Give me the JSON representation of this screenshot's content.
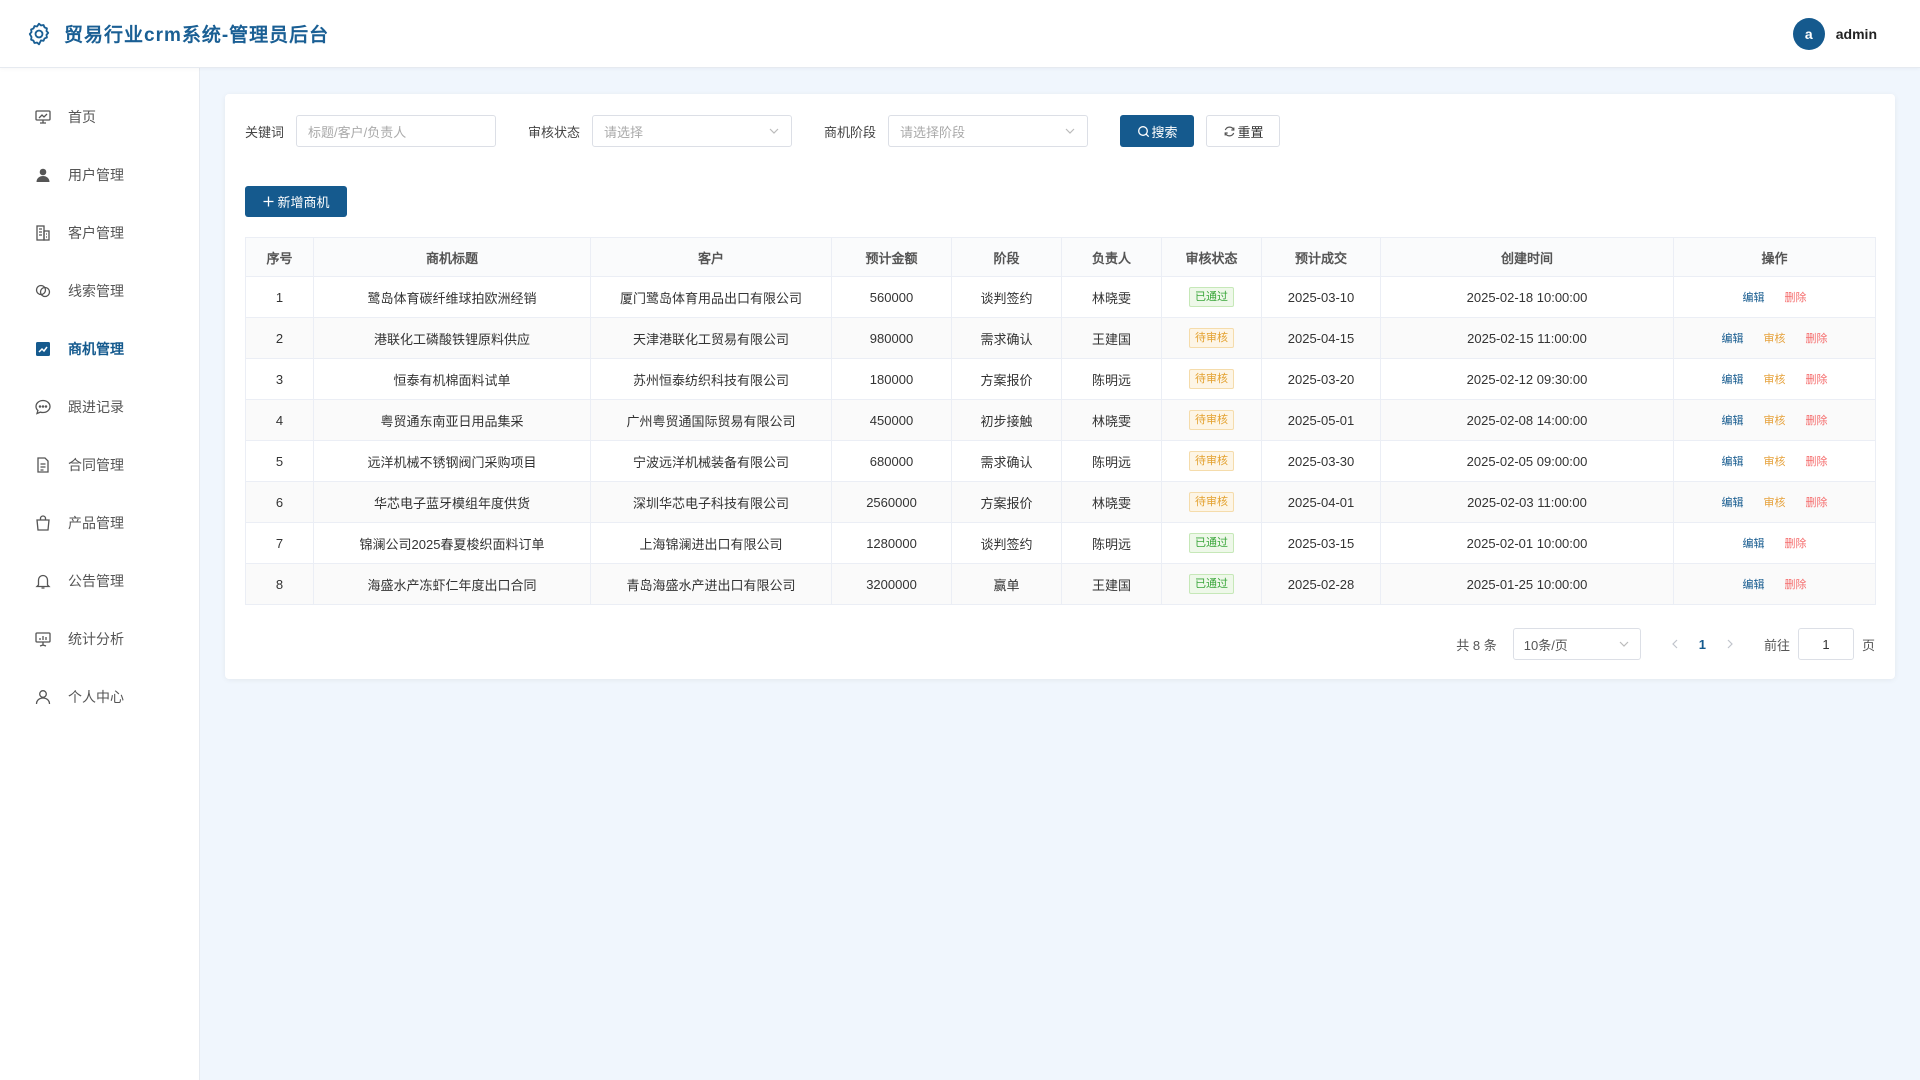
{
  "header": {
    "title": "贸易行业crm系统-管理员后台",
    "avatar_letter": "a",
    "username": "admin"
  },
  "sidebar": {
    "items": [
      {
        "label": "首页",
        "icon": "chart-board-icon"
      },
      {
        "label": "用户管理",
        "icon": "user-icon"
      },
      {
        "label": "客户管理",
        "icon": "building-icon"
      },
      {
        "label": "线索管理",
        "icon": "link-icon"
      },
      {
        "label": "商机管理",
        "icon": "trend-chart-icon",
        "active": true
      },
      {
        "label": "跟进记录",
        "icon": "chat-dot-icon"
      },
      {
        "label": "合同管理",
        "icon": "document-icon"
      },
      {
        "label": "产品管理",
        "icon": "bag-icon"
      },
      {
        "label": "公告管理",
        "icon": "bell-icon"
      },
      {
        "label": "统计分析",
        "icon": "presentation-icon"
      },
      {
        "label": "个人中心",
        "icon": "person-icon"
      }
    ]
  },
  "filters": {
    "keyword_label": "关键词",
    "keyword_placeholder": "标题/客户/负责人",
    "audit_label": "审核状态",
    "audit_placeholder": "请选择",
    "stage_label": "商机阶段",
    "stage_placeholder": "请选择阶段",
    "search_label": "搜索",
    "reset_label": "重置"
  },
  "add_button": "新增商机",
  "table": {
    "columns": [
      "序号",
      "商机标题",
      "客户",
      "预计金额",
      "阶段",
      "负责人",
      "审核状态",
      "预计成交",
      "创建时间",
      "操作"
    ],
    "rows": [
      {
        "no": "1",
        "title": "鹭岛体育碳纤维球拍欧洲经销",
        "customer": "厦门鹭岛体育用品出口有限公司",
        "amount": "560000",
        "stage": "谈判签约",
        "owner": "林晓雯",
        "status": "已通过",
        "status_type": "pass",
        "deal": "2025-03-10",
        "created": "2025-02-18 10:00:00",
        "audit": false
      },
      {
        "no": "2",
        "title": "港联化工磷酸铁锂原料供应",
        "customer": "天津港联化工贸易有限公司",
        "amount": "980000",
        "stage": "需求确认",
        "owner": "王建国",
        "status": "待审核",
        "status_type": "wait",
        "deal": "2025-04-15",
        "created": "2025-02-15 11:00:00",
        "audit": true
      },
      {
        "no": "3",
        "title": "恒泰有机棉面料试单",
        "customer": "苏州恒泰纺织科技有限公司",
        "amount": "180000",
        "stage": "方案报价",
        "owner": "陈明远",
        "status": "待审核",
        "status_type": "wait",
        "deal": "2025-03-20",
        "created": "2025-02-12 09:30:00",
        "audit": true
      },
      {
        "no": "4",
        "title": "粤贸通东南亚日用品集采",
        "customer": "广州粤贸通国际贸易有限公司",
        "amount": "450000",
        "stage": "初步接触",
        "owner": "林晓雯",
        "status": "待审核",
        "status_type": "wait",
        "deal": "2025-05-01",
        "created": "2025-02-08 14:00:00",
        "audit": true
      },
      {
        "no": "5",
        "title": "远洋机械不锈钢阀门采购项目",
        "customer": "宁波远洋机械装备有限公司",
        "amount": "680000",
        "stage": "需求确认",
        "owner": "陈明远",
        "status": "待审核",
        "status_type": "wait",
        "deal": "2025-03-30",
        "created": "2025-02-05 09:00:00",
        "audit": true
      },
      {
        "no": "6",
        "title": "华芯电子蓝牙模组年度供货",
        "customer": "深圳华芯电子科技有限公司",
        "amount": "2560000",
        "stage": "方案报价",
        "owner": "林晓雯",
        "status": "待审核",
        "status_type": "wait",
        "deal": "2025-04-01",
        "created": "2025-02-03 11:00:00",
        "audit": true
      },
      {
        "no": "7",
        "title": "锦澜公司2025春夏梭织面料订单",
        "customer": "上海锦澜进出口有限公司",
        "amount": "1280000",
        "stage": "谈判签约",
        "owner": "陈明远",
        "status": "已通过",
        "status_type": "pass",
        "deal": "2025-03-15",
        "created": "2025-02-01 10:00:00",
        "audit": false
      },
      {
        "no": "8",
        "title": "海盛水产冻虾仁年度出口合同",
        "customer": "青岛海盛水产进出口有限公司",
        "amount": "3200000",
        "stage": "赢单",
        "owner": "王建国",
        "status": "已通过",
        "status_type": "pass",
        "deal": "2025-02-28",
        "created": "2025-01-25 10:00:00",
        "audit": false
      }
    ],
    "op_edit": "编辑",
    "op_audit": "审核",
    "op_delete": "删除"
  },
  "pagination": {
    "total": "共 8 条",
    "page_size": "10条/页",
    "current_page": "1",
    "goto_label": "前往",
    "goto_value": "1",
    "page_unit": "页"
  }
}
